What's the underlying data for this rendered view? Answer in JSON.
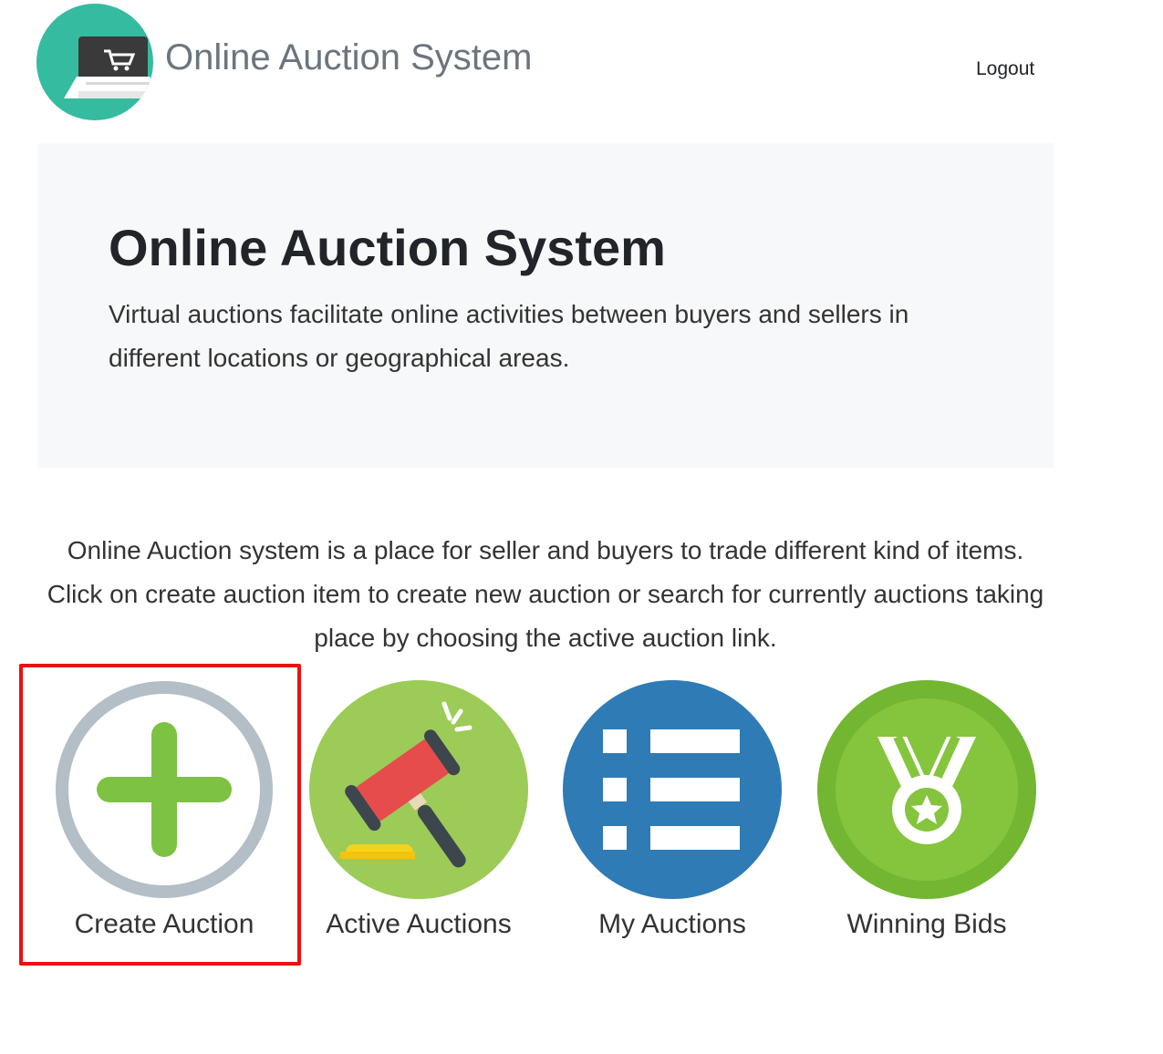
{
  "header": {
    "brand": "Online Auction System",
    "logout": "Logout"
  },
  "jumbotron": {
    "title": "Online Auction System",
    "lead": "Virtual auctions facilitate online activities between buyers and sellers in different locations or geographical areas."
  },
  "intro": "Online Auction system is a place for seller and buyers to trade different kind of items. Click on create auction item to create new auction or search for currently auctions taking place by choosing the active auction link.",
  "tiles": [
    {
      "label": "Create Auction",
      "icon": "plus-circle-icon"
    },
    {
      "label": "Active Auctions",
      "icon": "gavel-icon"
    },
    {
      "label": "My Auctions",
      "icon": "list-icon"
    },
    {
      "label": "Winning Bids",
      "icon": "medal-icon"
    }
  ],
  "colors": {
    "logo_bg": "#35bba0",
    "highlight": "#ee0f0f",
    "jumbotron_bg": "#f7f8f9",
    "green": "#7dc242",
    "blue": "#2e7bb6"
  }
}
